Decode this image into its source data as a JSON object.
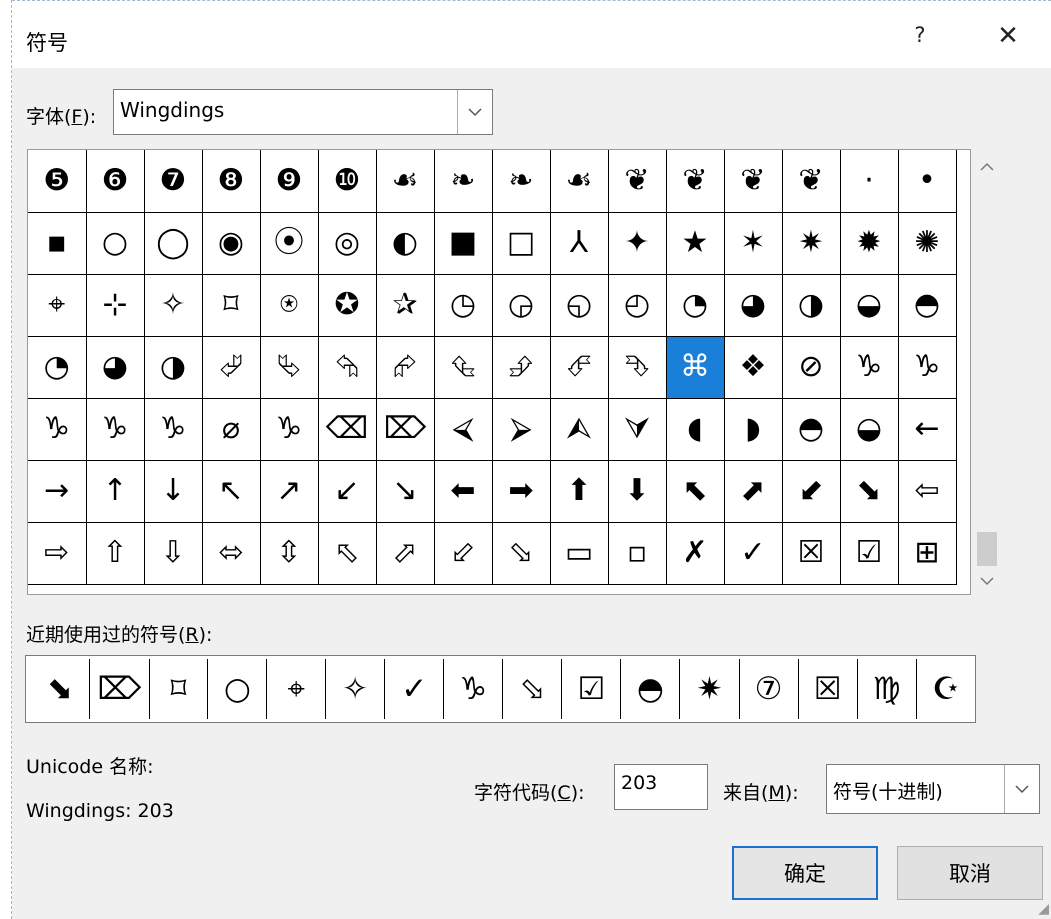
{
  "dialog": {
    "title": "符号",
    "help_label": "?",
    "close_label": "✕"
  },
  "font": {
    "label_prefix": "字体(",
    "label_key": "F",
    "label_suffix": "):",
    "value": "Wingdings"
  },
  "symbols": [
    [
      "❺",
      "❻",
      "❼",
      "❽",
      "❾",
      "❿",
      "☙",
      "❧",
      "❧",
      "☙",
      "❦",
      "❦",
      "❦",
      "❦",
      "·",
      "•"
    ],
    [
      "▪",
      "○",
      "◯",
      "◉",
      "⦿",
      "◎",
      "◐",
      "■",
      "□",
      "⅄",
      "✦",
      "★",
      "✶",
      "✷",
      "✹",
      "✺"
    ],
    [
      "⌖",
      "⊹",
      "✧",
      "⌑",
      "⍟",
      "✪",
      "✰",
      "◷",
      "◶",
      "◵",
      "◴",
      "◔",
      "◕",
      "◑",
      "◒",
      "◓"
    ],
    [
      "◔",
      "◕",
      "◑",
      "⮰",
      "⮱",
      "⮲",
      "⮳",
      "⮴",
      "⮵",
      "⮶",
      "⮷",
      "⌘",
      "❖",
      "⊘",
      "♑",
      "♑"
    ],
    [
      "♑",
      "♑",
      "♑",
      "⌀",
      "♑",
      "⌫",
      "⌦",
      "⮘",
      "⮚",
      "⮙",
      "⮛",
      "◖",
      "◗",
      "◓",
      "◒",
      "←"
    ],
    [
      "→",
      "↑",
      "↓",
      "↖",
      "↗",
      "↙",
      "↘",
      "⬅",
      "➡",
      "⬆",
      "⬇",
      "⬉",
      "⬈",
      "⬋",
      "⬊",
      "⇦"
    ],
    [
      "⇨",
      "⇧",
      "⇩",
      "⬄",
      "⇳",
      "⬁",
      "⬀",
      "⬃",
      "⬂",
      "▭",
      "▫",
      "✗",
      "✓",
      "☒",
      "☑",
      "⊞"
    ]
  ],
  "selected": {
    "row": 3,
    "col": 11
  },
  "recent": {
    "label_prefix": "近期使用过的符号(",
    "label_key": "R",
    "label_suffix": "):",
    "items": [
      "⬊",
      "⌦",
      "⌑",
      "○",
      "⌖",
      "✧",
      "✓",
      "♑",
      "⬂",
      "☑",
      "◓",
      "✷",
      "⑦",
      "☒",
      "♍",
      "☪"
    ]
  },
  "unicode_name_label": "Unicode 名称:",
  "current_char": "Wingdings: 203",
  "char_code": {
    "label_prefix": "字符代码(",
    "label_key": "C",
    "label_suffix": "):",
    "value": "203"
  },
  "from": {
    "label_prefix": "来自(",
    "label_key": "M",
    "label_suffix": "):",
    "value": "符号(十进制)"
  },
  "buttons": {
    "ok": "确定",
    "cancel": "取消"
  },
  "colors": {
    "selection": "#1a7fd8",
    "ok_border": "#1d6fd2",
    "dialog_bg": "#f0f0f0"
  }
}
